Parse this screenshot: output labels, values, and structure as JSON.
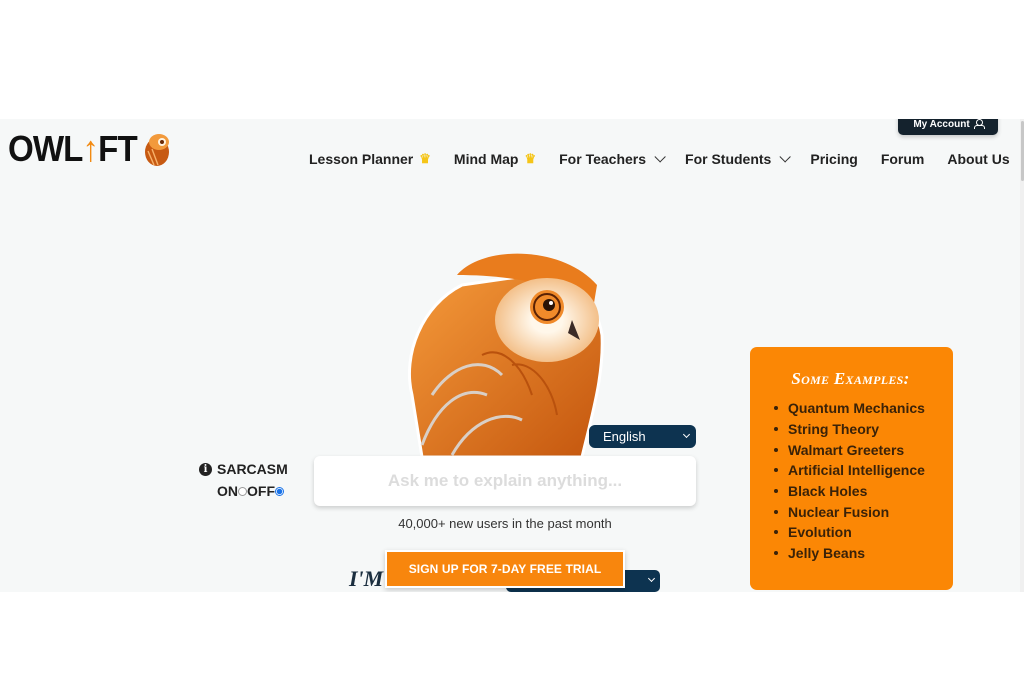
{
  "brand": {
    "name_part1": "OWL",
    "name_arrow": "↑",
    "name_part2": "FT",
    "accent": "#f28a12"
  },
  "header": {
    "account_label": "My Account",
    "account_icon": "user-icon",
    "nav": [
      {
        "label": "Lesson Planner",
        "icon": "crown-icon"
      },
      {
        "label": "Mind Map",
        "icon": "crown-icon"
      },
      {
        "label": "For Teachers",
        "icon": "chevron-down-icon"
      },
      {
        "label": "For Students",
        "icon": "chevron-down-icon"
      },
      {
        "label": "Pricing"
      },
      {
        "label": "Forum"
      },
      {
        "label": "About Us"
      }
    ]
  },
  "hero": {
    "language_selected": "English",
    "sarcasm_label": "SARCASM",
    "sarcasm_on": "ON",
    "sarcasm_off": "OFF",
    "sarcasm_value": "OFF",
    "ask_placeholder": "Ask me to explain anything...",
    "users_text": "40,000+ new users in the past month",
    "signup_label": "SIGN UP FOR 7-DAY FREE TRIAL",
    "im_text": "I'M"
  },
  "examples": {
    "title": "Some Examples:",
    "items": [
      "Quantum Mechanics",
      "String Theory",
      "Walmart Greeters",
      "Artificial Intelligence",
      "Black Holes",
      "Nuclear Fusion",
      "Evolution",
      "Jelly Beans"
    ]
  },
  "colors": {
    "navy": "#0d3350",
    "orange": "#fb8705",
    "crown": "#f5c518"
  }
}
